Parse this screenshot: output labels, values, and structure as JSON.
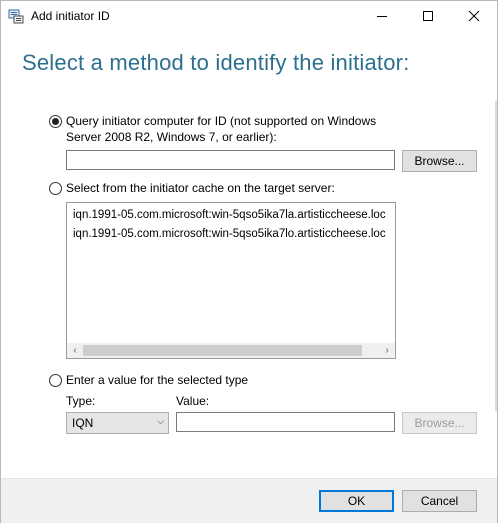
{
  "window": {
    "title": "Add initiator ID",
    "icon": "iscsi-initiator-icon",
    "controls": [
      "minimize-icon",
      "maximize-icon",
      "close-icon"
    ]
  },
  "heading": "Select a method to identify the initiator:",
  "option_query": {
    "label_line1": "Query initiator computer for ID (not supported on Windows",
    "label_line2": "Server 2008 R2, Windows 7, or earlier):",
    "selected": true,
    "input_value": "",
    "browse_label": "Browse..."
  },
  "option_cache": {
    "label": "Select from the initiator cache on the target server:",
    "selected": false,
    "items": [
      "iqn.1991-05.com.microsoft:win-5qso5ika7la.artisticcheese.loc",
      "iqn.1991-05.com.microsoft:win-5qso5ika7lo.artisticcheese.loc"
    ]
  },
  "option_value": {
    "label": "Enter a value for the selected type",
    "selected": false,
    "type_label": "Type:",
    "value_label": "Value:",
    "type_selected": "IQN",
    "value_input": "",
    "browse_label": "Browse..."
  },
  "footer": {
    "ok_label": "OK",
    "cancel_label": "Cancel"
  },
  "colors": {
    "heading": "#2c6f8e",
    "footer_bg": "#f0f0f0",
    "default_button_border": "#0078d7"
  }
}
